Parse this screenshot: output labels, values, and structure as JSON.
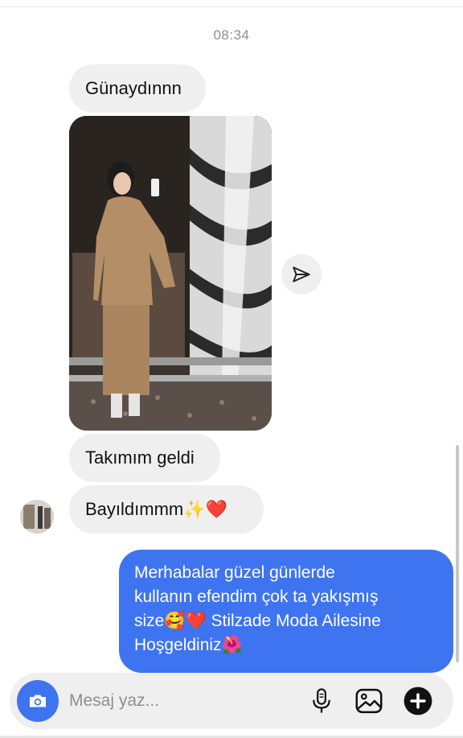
{
  "chat": {
    "timestamp": "08:34",
    "incoming": [
      {
        "text": "Günaydınnn"
      },
      {
        "text": "Takımım geldi"
      },
      {
        "text": "Bayıldımmm✨❤️"
      }
    ],
    "outgoing": {
      "lines": [
        "Merhabalar güzel günlerde",
        "kullanın efendim çok ta yakışmış",
        "size🥰❤️ Stilzade Moda Ailesine",
        "Hoşgeldiniz🌺"
      ]
    }
  },
  "composer": {
    "placeholder": "Mesaj yaz..."
  },
  "colors": {
    "accent": "#3e74f0",
    "incoming_bubble": "#efefef",
    "timestamp": "#8e8e8e"
  },
  "icons": {
    "camera": "camera-icon",
    "share": "send-icon",
    "mic": "microphone-icon",
    "gallery": "gallery-icon",
    "plus": "plus-icon"
  }
}
